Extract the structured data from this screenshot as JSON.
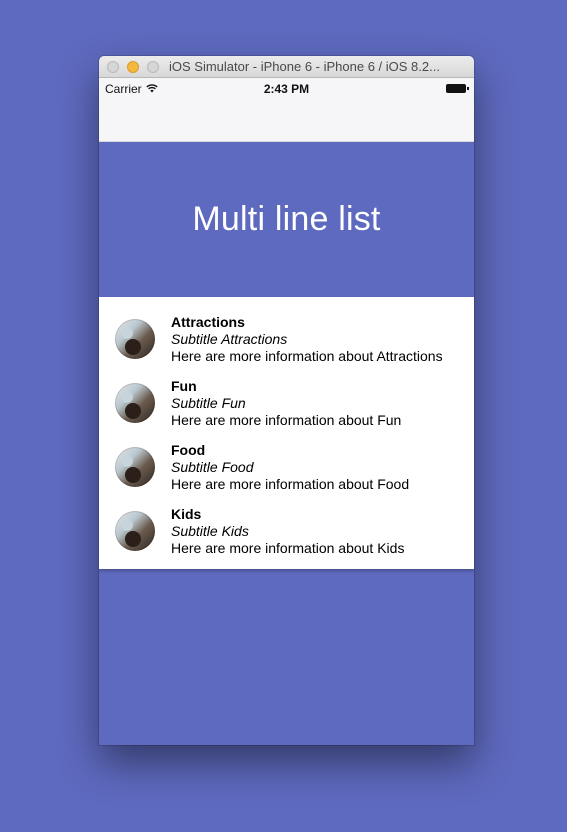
{
  "window": {
    "title": "iOS Simulator - iPhone 6 - iPhone 6 / iOS 8.2..."
  },
  "status_bar": {
    "carrier": "Carrier",
    "time": "2:43 PM"
  },
  "header": {
    "title": "Multi line list",
    "color": "#5e6abf"
  },
  "list": {
    "items": [
      {
        "title": "Attractions",
        "subtitle": "Subtitle Attractions",
        "description": "Here are more information about Attractions"
      },
      {
        "title": "Fun",
        "subtitle": "Subtitle Fun",
        "description": "Here are more information about Fun"
      },
      {
        "title": "Food",
        "subtitle": "Subtitle Food",
        "description": "Here are more information about Food"
      },
      {
        "title": "Kids",
        "subtitle": "Subtitle Kids",
        "description": "Here are more information about Kids"
      }
    ]
  }
}
